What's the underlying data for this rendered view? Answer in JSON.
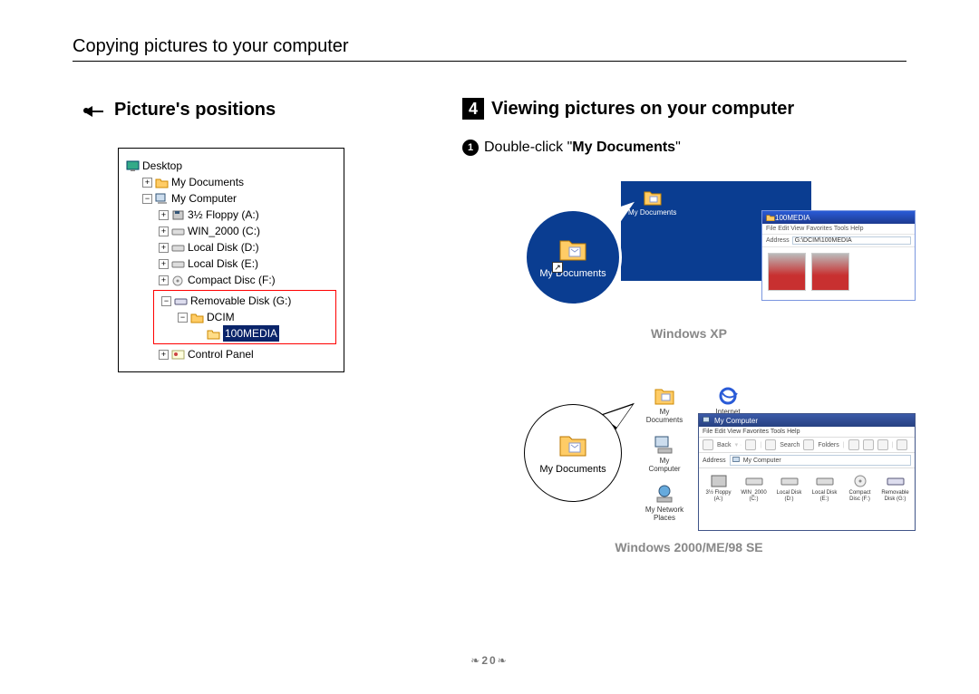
{
  "header": {
    "title": "Copying pictures to your computer"
  },
  "left": {
    "heading": "Picture's positions",
    "tree": {
      "desktop": "Desktop",
      "my_documents": "My Documents",
      "my_computer": "My Computer",
      "floppy": "3½ Floppy (A:)",
      "win2000": "WIN_2000 (C:)",
      "local_d": "Local Disk (D:)",
      "local_e": "Local Disk (E:)",
      "compact_disc": "Compact Disc (F:)",
      "removable": "Removable Disk (G:)",
      "dcim": "DCIM",
      "media100": "100MEDIA",
      "control_panel": "Control Panel"
    }
  },
  "right": {
    "step_number": "4",
    "step_title": "Viewing pictures on your computer",
    "sub1_num": "1",
    "sub1_prefix": "Double-click \"",
    "sub1_bold": "My Documents",
    "sub1_suffix": "\"",
    "callout_label": "My Documents",
    "xp": {
      "desktop_icon_label": "My Documents",
      "window_title": "100MEDIA",
      "menu": "File  Edit  View  Favorites  Tools  Help",
      "address_label": "Address",
      "address_value": "G:\\DCIM\\100MEDIA",
      "os_label": "Windows XP"
    },
    "w2k": {
      "icons": {
        "my_documents": "My Documents",
        "ie": "Internet Explorer",
        "my_computer": "My Computer",
        "network": "My Network Places"
      },
      "window_title": "My Computer",
      "menu": "File   Edit   View   Favorites   Tools   Help",
      "tb_back": "Back",
      "tb_search": "Search",
      "tb_folders": "Folders",
      "address_label": "Address",
      "address_value": "My Computer",
      "drives": {
        "floppy": "3½ Floppy (A:)",
        "win2000": "WIN_2000 (C:)",
        "local_d": "Local Disk (D:)",
        "local_e": "Local Disk (E:)",
        "compact": "Compact Disc (F:)",
        "removable": "Removable Disk (G:)"
      },
      "os_label": "Windows 2000/ME/98 SE"
    }
  },
  "footer": {
    "page": "20"
  }
}
